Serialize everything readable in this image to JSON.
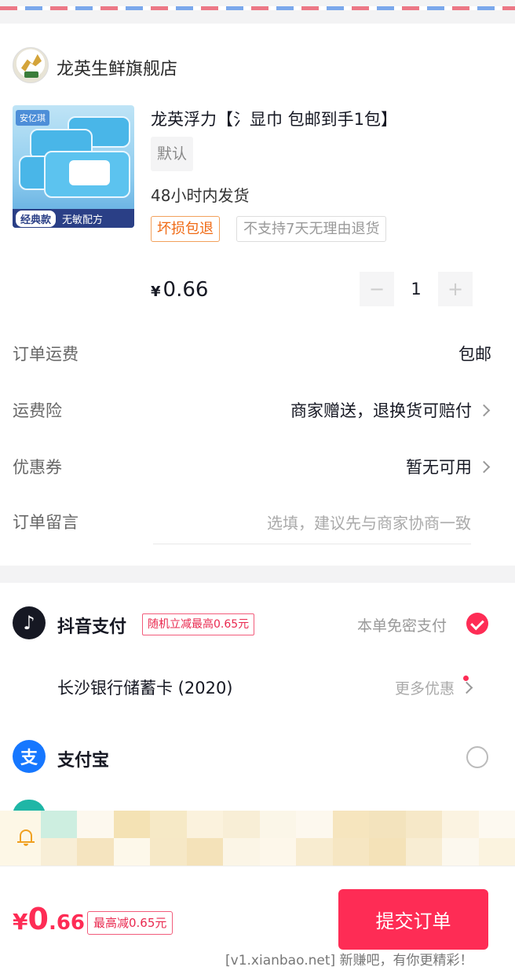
{
  "store": {
    "name": "龙英生鲜旗舰店"
  },
  "product": {
    "title": "龙英浮力【氵显巾   包邮到手1包】",
    "spec": "默认",
    "shipping_time": "48小时内发货",
    "badge_damage": "坏损包退",
    "badge_no_return": "不支持7天无理由退货",
    "image_tag_top": "安亿琪",
    "image_tag_left": "经典款",
    "image_tag_right": "无敏配方",
    "price_symbol": "¥",
    "price": "0.66",
    "quantity": "1",
    "minus": "−",
    "plus": "+"
  },
  "order_rows": {
    "freight_label": "订单运费",
    "freight_value": "包邮",
    "insurance_label": "运费险",
    "insurance_value": "商家赠送，退换货可赔付",
    "coupon_label": "优惠券",
    "coupon_value": "暂无可用",
    "message_label": "订单留言",
    "message_placeholder": "选填，建议先与商家协商一致"
  },
  "payment": {
    "douyin_name": "抖音支付",
    "douyin_promo": "随机立减最高0.65元",
    "douyin_nopwd": "本单免密支付",
    "bank_card": "长沙银行储蓄卡 (2020)",
    "more_offers": "更多优惠",
    "alipay_name": "支付宝",
    "alipay_glyph": "支"
  },
  "bottom": {
    "total_symbol": "¥",
    "total_int": "0",
    "total_dec": ".66",
    "max_discount": "最高减0.65元",
    "submit": "提交订单"
  },
  "watermark": "[v1.xianbao.net] 新赚吧，有你更精彩！",
  "colors": {
    "accent": "#fe2c55",
    "orange": "#f06a14",
    "alipay": "#1677ff"
  }
}
